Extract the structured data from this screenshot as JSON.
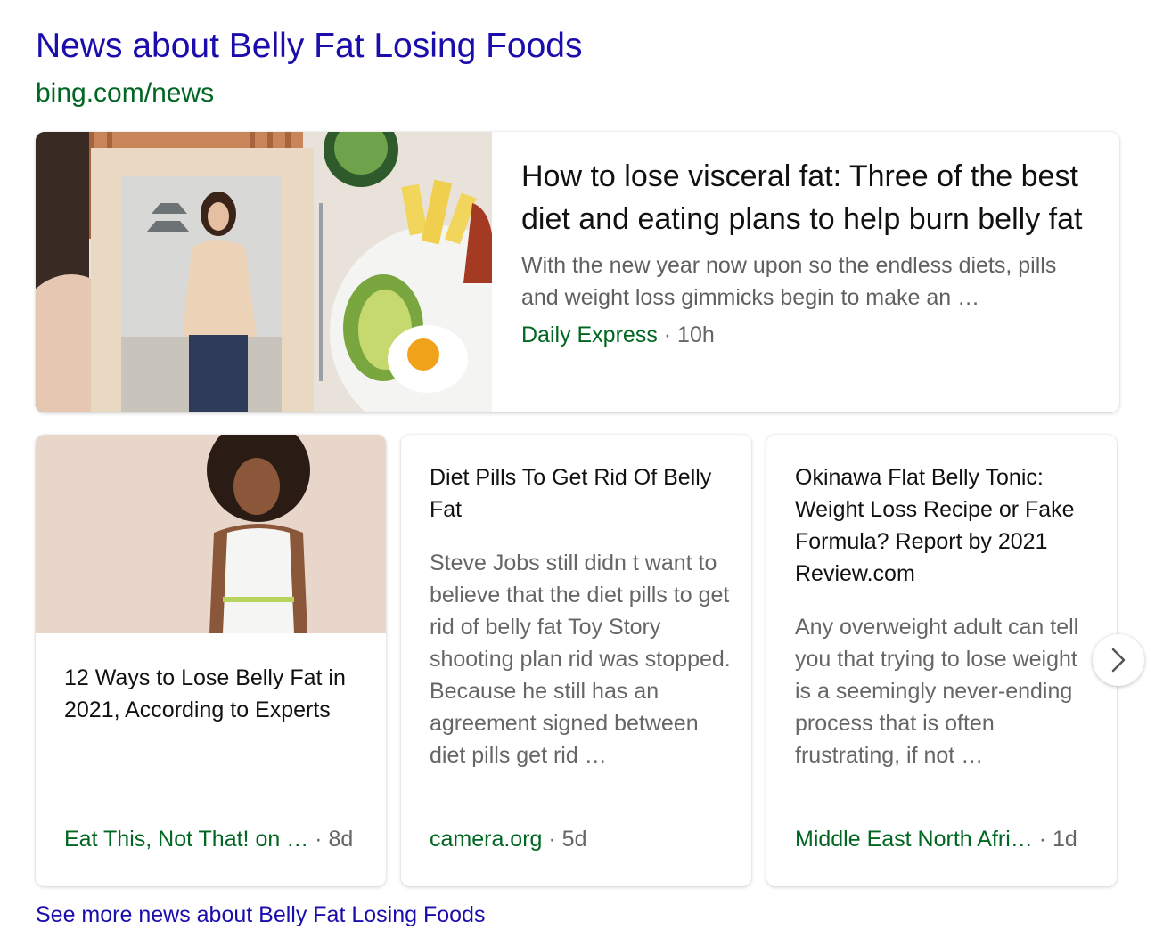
{
  "header": {
    "title": "News about Belly Fat Losing Foods",
    "source_url": "bing.com/news"
  },
  "featured": {
    "headline": "How to lose visceral fat: Three of the best diet and eating plans to help burn belly fat",
    "snippet": "With the new year now upon so the endless diets, pills and weight loss gimmicks begin to make an …",
    "source": "Daily Express",
    "separator": " · ",
    "age": "10h",
    "image": "woman-in-mirror-and-plate-of-food-photo"
  },
  "cards": [
    {
      "headline": "12 Ways to Lose Belly Fat in 2021, According to Experts",
      "snippet": "",
      "source": "Eat This, Not That! on …",
      "separator": " · ",
      "age": "8d",
      "image": "woman-measuring-waist-photo"
    },
    {
      "headline": "Diet Pills To Get Rid Of Belly Fat",
      "snippet": "Steve Jobs still didn t want to believe that the diet pills to get rid of belly fat Toy Story shooting plan rid was stopped. Because he still has an agreement signed between diet pills get rid …",
      "source": "camera.org",
      "separator": " · ",
      "age": "5d"
    },
    {
      "headline": "Okinawa Flat Belly Tonic: Weight Loss Recipe or Fake Formula? Report by 2021 Review.com",
      "snippet": "Any overweight adult can tell you that trying to lose weight is a seemingly never-ending process that is often frustrating, if not …",
      "source": "Middle East North Afri…",
      "separator": " · ",
      "age": "1d"
    }
  ],
  "next_button": {
    "icon": "chevron-right-icon"
  },
  "footer": {
    "see_more": "See more news about Belly Fat Losing Foods"
  },
  "colors": {
    "link": "#1a0dab",
    "source_green": "#006621",
    "meta_gray": "#666666"
  }
}
